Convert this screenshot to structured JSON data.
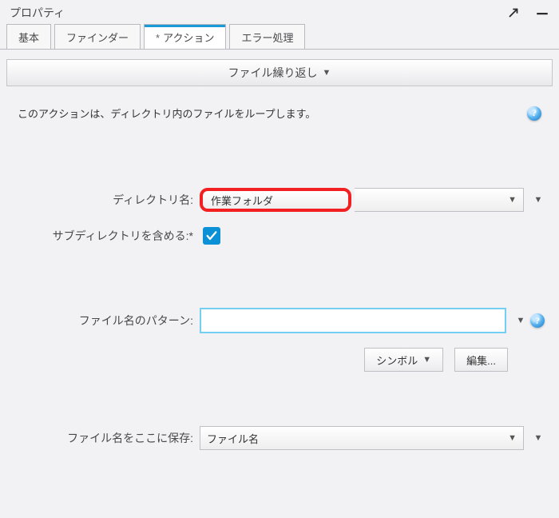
{
  "window": {
    "title": "プロパティ"
  },
  "tabs": [
    {
      "label": "基本"
    },
    {
      "label": "ファインダー"
    },
    {
      "label": "アクション",
      "dirty": "*",
      "active": true
    },
    {
      "label": "エラー処理"
    }
  ],
  "step": {
    "title": "ファイル繰り返し"
  },
  "description": "このアクションは、ディレクトリ内のファイルをループします。",
  "fields": {
    "directory": {
      "label": "ディレクトリ名:",
      "value": "作業フォルダ"
    },
    "includeSubdirs": {
      "label": "サブディレクトリを含める:",
      "dirty": "*",
      "checked": true
    },
    "pattern": {
      "label": "ファイル名のパターン:",
      "value": ""
    },
    "saveTo": {
      "label": "ファイル名をここに保存:",
      "value": "ファイル名"
    }
  },
  "buttons": {
    "symbol": "シンボル",
    "edit": "編集..."
  },
  "glyphs": {
    "help": "?"
  }
}
